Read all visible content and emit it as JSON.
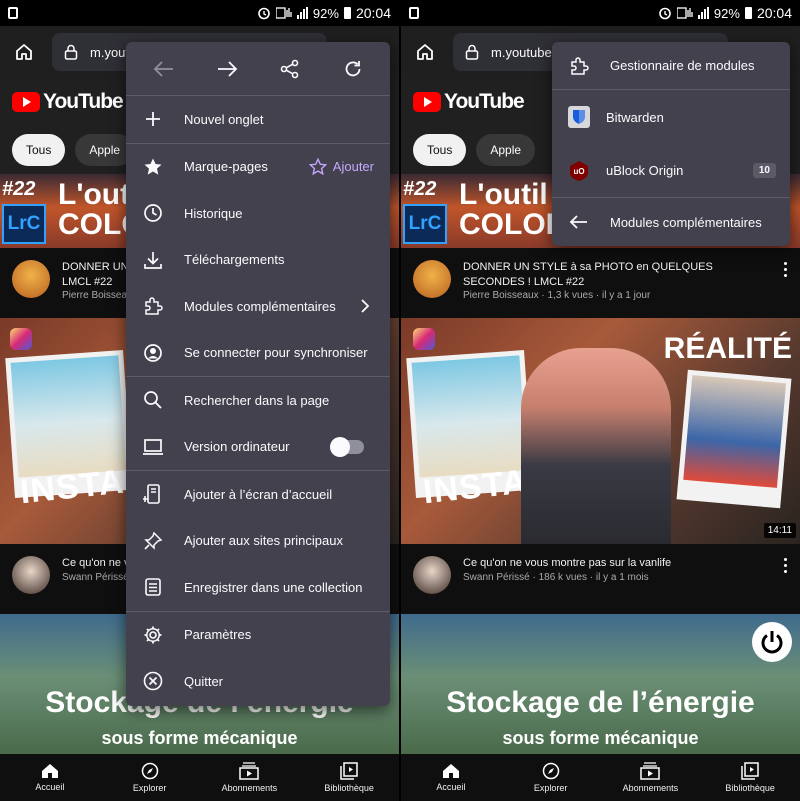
{
  "status_bar": {
    "battery": "92%",
    "time": "20:04"
  },
  "left": {
    "url": "m.youtu",
    "menu": {
      "items": [
        {
          "label": "Nouvel onglet",
          "icon": "plus-icon"
        },
        {
          "label": "Marque-pages",
          "icon": "star-icon",
          "action_label": "Ajouter"
        },
        {
          "label": "Historique",
          "icon": "clock-icon"
        },
        {
          "label": "Téléchargements",
          "icon": "download-icon"
        },
        {
          "label": "Modules complémentaires",
          "icon": "puzzle-icon"
        },
        {
          "label": "Se connecter pour synchroniser",
          "icon": "account-icon"
        },
        {
          "label": "Rechercher dans la page",
          "icon": "search-icon"
        },
        {
          "label": "Version ordinateur",
          "icon": "desktop-icon",
          "toggle_on": false
        },
        {
          "label": "Ajouter à l’écran d’accueil",
          "icon": "add-to-home-icon"
        },
        {
          "label": "Ajouter aux sites principaux",
          "icon": "pin-icon"
        },
        {
          "label": "Enregistrer dans une collection",
          "icon": "collection-icon"
        },
        {
          "label": "Paramètres",
          "icon": "gear-icon"
        },
        {
          "label": "Quitter",
          "icon": "quit-icon"
        }
      ]
    },
    "video1": {
      "title": "DONNER UN",
      "title2": "LMCL #22",
      "channel": "Pierre Boisseau"
    },
    "video2": {
      "title": "Ce qu'on ne v",
      "channel": "Swann Périssé"
    }
  },
  "right": {
    "url": "m.youtube.co",
    "addons": {
      "manager_label": "Gestionnaire de modules",
      "items": [
        {
          "label": "Bitwarden",
          "icon": "bitwarden-icon"
        },
        {
          "label": "uBlock Origin",
          "icon": "ublock-icon",
          "badge": "10"
        }
      ],
      "back_label": "Modules complémentaires"
    },
    "video1": {
      "title": "DONNER UN STYLE à sa PHOTO en QUELQUES SECONDES ! LMCL #22",
      "channel": "Pierre Boisseaux",
      "views": "1,3 k vues",
      "age": "il y a 1 jour"
    },
    "video2": {
      "title": "Ce qu'on ne vous montre pas sur la vanlife",
      "channel": "Swann Périssé",
      "views": "186 k vues",
      "age": "il y a 1 mois",
      "duration": "14:11"
    }
  },
  "youtube": {
    "logo": "YouTube",
    "chips": [
      "Tous",
      "Apple"
    ],
    "thumb1": {
      "number": "#22",
      "app": "LrC",
      "line1": "L'outil",
      "line2": "COLOR"
    },
    "thumb2": {
      "insta": "INSTA",
      "realite": "RÉALITÉ"
    },
    "thumb3": {
      "line1": "Stockage de l’énergie",
      "line2": "sous forme mécanique"
    },
    "nav": [
      "Accueil",
      "Explorer",
      "Abonnements",
      "Bibliothèque"
    ]
  },
  "colors": {
    "menu_bg": "#42414d",
    "accent": "#c6a9ff",
    "yt_red": "#ff0000"
  }
}
